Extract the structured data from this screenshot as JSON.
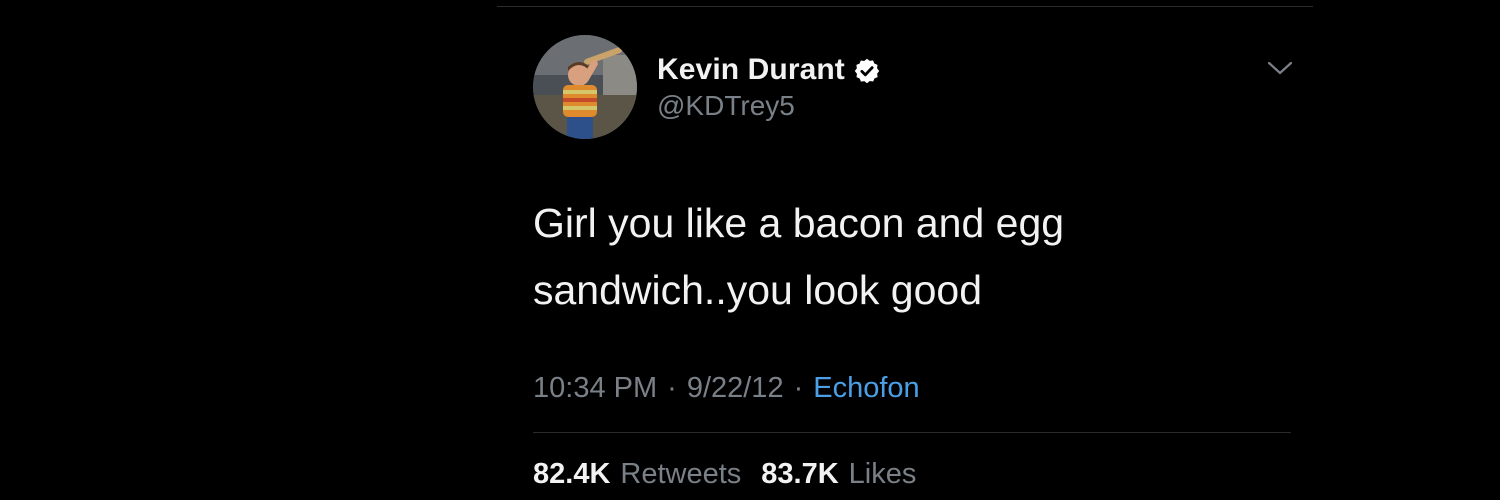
{
  "tweet": {
    "author": {
      "display_name": "Kevin Durant",
      "handle": "@KDTrey5",
      "verified": true
    },
    "text_lines": [
      "Girl you like a bacon and egg",
      "sandwich..you look good"
    ],
    "meta": {
      "time": "10:34 PM",
      "separator": "·",
      "date": "9/22/12",
      "source": "Echofon"
    },
    "stats": {
      "retweets_count": "82.4K",
      "retweets_label": "Retweets",
      "likes_count": "83.7K",
      "likes_label": "Likes"
    }
  },
  "theme": {
    "background": "#000000",
    "primary_text": "#f2f2f2",
    "secondary_text": "#7a8087",
    "link": "#4a9fe6",
    "divider": "#2b2b2b",
    "verified_badge": "#ffffff"
  },
  "icons": {
    "verified": "verified-badge-icon",
    "menu": "chevron-down-icon"
  }
}
